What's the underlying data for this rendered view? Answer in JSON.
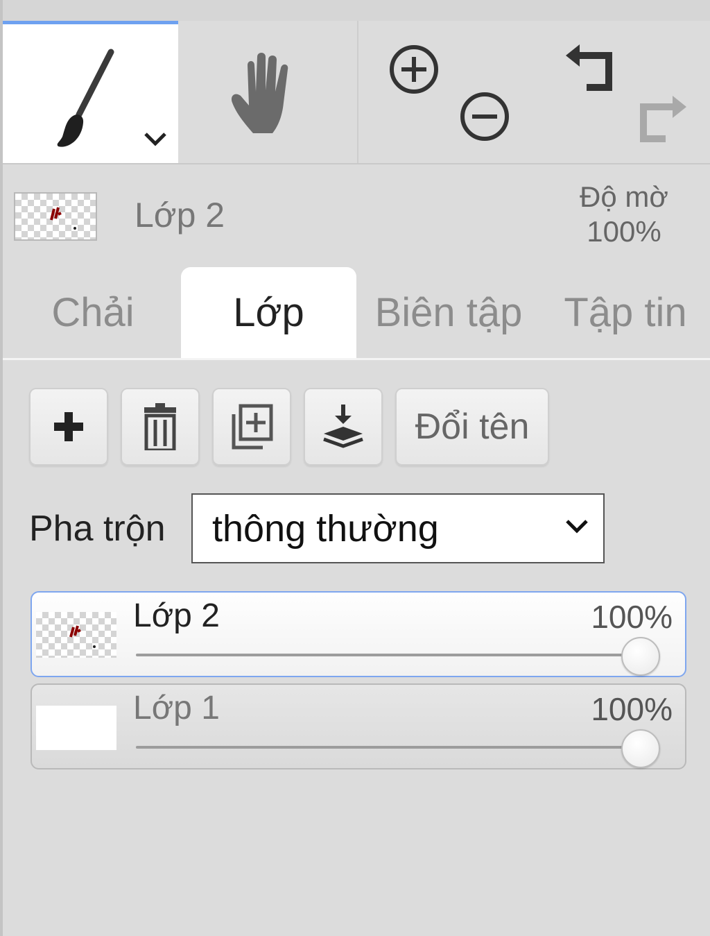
{
  "toolbar": {
    "tools": [
      {
        "id": "brush",
        "icon": "brush-icon",
        "active": true,
        "has_dropdown": true
      },
      {
        "id": "hand",
        "icon": "hand-icon",
        "active": false
      }
    ],
    "zoom": {
      "in_icon": "zoom-in-icon",
      "out_icon": "zoom-out-icon"
    },
    "history": {
      "undo_icon": "undo-icon",
      "redo_icon": "redo-icon",
      "redo_enabled": false
    },
    "accent_color": "#6ea1f0"
  },
  "current_layer": {
    "name": "Lớp 2",
    "opacity_label": "Độ mờ",
    "opacity_value": "100%"
  },
  "tabs": [
    {
      "label": "Chải",
      "active": false
    },
    {
      "label": "Lớp",
      "active": true
    },
    {
      "label": "Biên tập",
      "active": false
    },
    {
      "label": "Tập tin",
      "active": false
    }
  ],
  "layer_actions": {
    "add_icon": "plus-icon",
    "delete_icon": "trash-icon",
    "duplicate_icon": "duplicate-icon",
    "merge_icon": "merge-down-icon",
    "rename_label": "Đổi tên"
  },
  "blend": {
    "label": "Pha trộn",
    "value": "thông thường"
  },
  "layers": [
    {
      "name": "Lớp 2",
      "opacity_text": "100%",
      "opacity": 1.0,
      "selected": true,
      "thumbnail": "transparent-with-marks"
    },
    {
      "name": "Lớp 1",
      "opacity_text": "100%",
      "opacity": 1.0,
      "selected": false,
      "thumbnail": "white"
    }
  ]
}
